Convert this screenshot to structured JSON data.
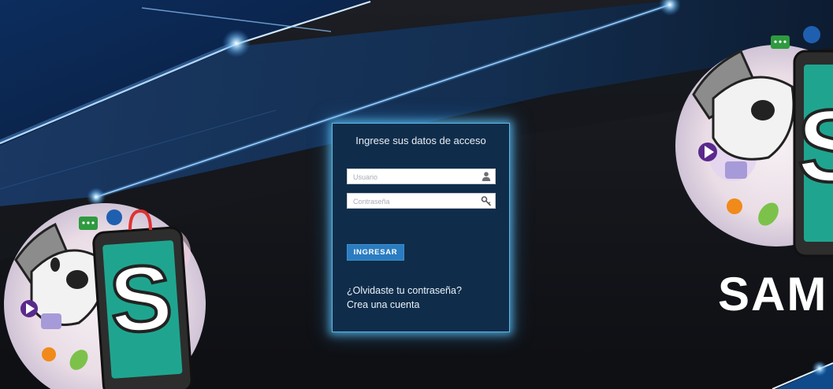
{
  "login": {
    "title": "Ingrese sus datos de acceso",
    "username_placeholder": "Usuario",
    "password_placeholder": "Contraseña",
    "submit_label": "INGRESAR",
    "forgot_password_label": "¿Olvidaste tu contraseña?",
    "create_account_label": "Crea una cuenta"
  },
  "brand": {
    "logo_text": "SAM",
    "logo_letter": "S",
    "accent_teal": "#1fa58f",
    "accent_blue": "#2b7cc0"
  },
  "icons": {
    "username": "user-icon",
    "password": "key-icon"
  }
}
